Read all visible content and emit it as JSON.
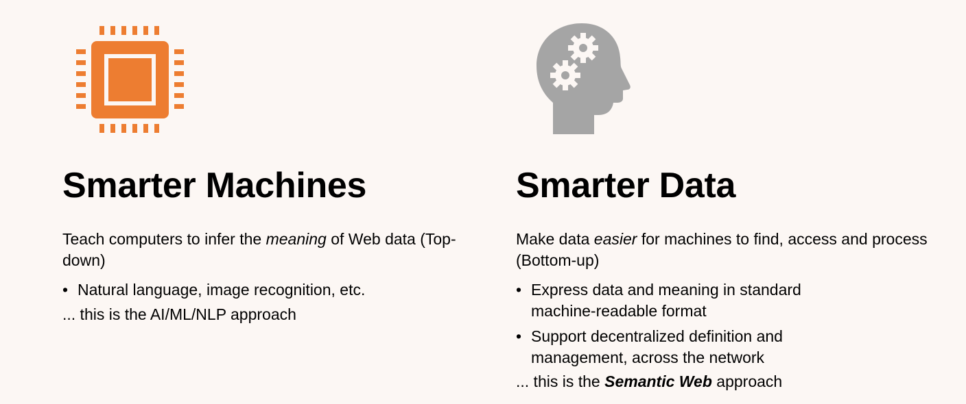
{
  "colors": {
    "background": "#fcf7f4",
    "chip_orange": "#ed7d31",
    "head_gray": "#a5a5a5"
  },
  "left": {
    "icon": "cpu-chip-icon",
    "title": "Smarter Machines",
    "intro_before": "Teach computers to infer the ",
    "intro_em": "meaning",
    "intro_after": " of Web data  (Top-down)",
    "bullets": [
      "Natural language, image recognition, etc."
    ],
    "closing": "... this is the AI/ML/NLP approach"
  },
  "right": {
    "icon": "head-gears-icon",
    "title": "Smarter Data",
    "intro_before": "Make data ",
    "intro_em": "easier",
    "intro_after": " for machines to find, access and process (Bottom-up)",
    "bullets": [
      "Express data and meaning in standard machine-readable format",
      "Support decentralized definition and management, across the network"
    ],
    "closing_before": "... this is the ",
    "closing_bold": "Semantic Web",
    "closing_after": " approach"
  }
}
